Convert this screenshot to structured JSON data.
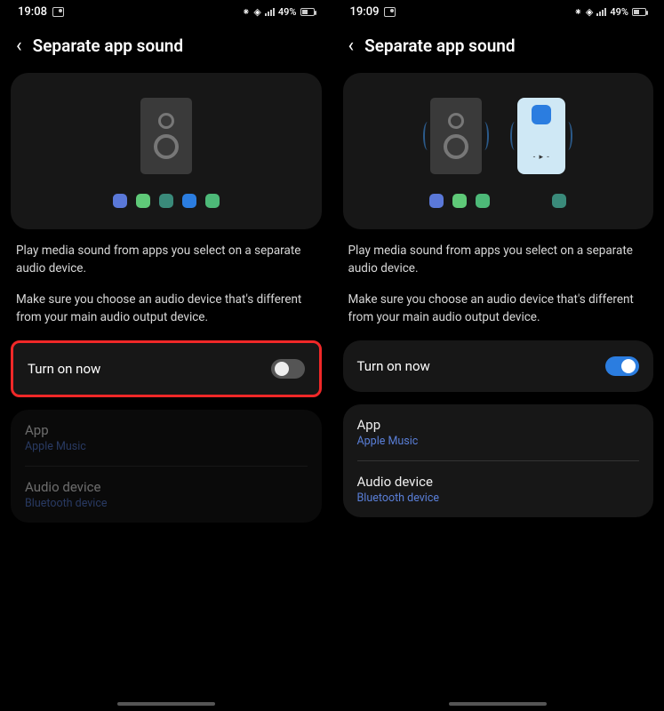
{
  "left": {
    "time": "19:08",
    "battery": "49%",
    "title": "Separate app sound",
    "dots": [
      "#5a78d8",
      "#5fc978",
      "#3a8a7a",
      "#2b7de0",
      "#4db978"
    ],
    "desc1": "Play media sound from apps you select on a separate audio device.",
    "desc2": "Make sure you choose an audio device that's different from your main audio output device.",
    "toggle_label": "Turn on now",
    "toggle_on": false,
    "app_label": "App",
    "app_value": "Apple Music",
    "device_label": "Audio device",
    "device_value": "Bluetooth device"
  },
  "right": {
    "time": "19:09",
    "battery": "49%",
    "title": "Separate app sound",
    "dots_left": [
      "#5a78d8",
      "#5fc978",
      "#4db978"
    ],
    "dots_right": [
      "#3a8a7a"
    ],
    "desc1": "Play media sound from apps you select on a separate audio device.",
    "desc2": "Make sure you choose an audio device that's different from your main audio output device.",
    "toggle_label": "Turn on now",
    "toggle_on": true,
    "app_label": "App",
    "app_value": "Apple Music",
    "device_label": "Audio device",
    "device_value": "Bluetooth device"
  }
}
